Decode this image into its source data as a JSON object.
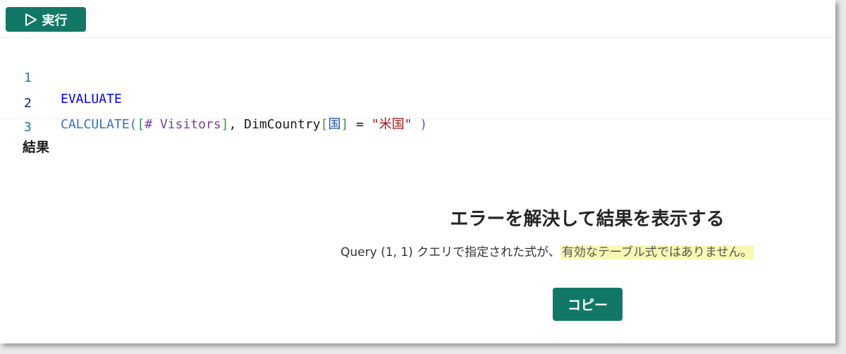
{
  "toolbar": {
    "run_label": "実行",
    "run_icon": "play-outline-icon",
    "accent": "#117865"
  },
  "editor": {
    "lines": [
      {
        "number": "1",
        "text": "EVALUATE"
      },
      {
        "number": "2",
        "text": "CALCULATE([# Visitors], DimCountry[国] = \"米国\" )",
        "tokens": {
          "fn": "CALCULATE",
          "open_paren": "(",
          "open_bracket": "[",
          "measure": "# Visitors",
          "close_bracket": "]",
          "comma": ",",
          "table": "DimCountry",
          "col_open": "[",
          "column": "国",
          "col_close": "]",
          "eq": "=",
          "string": "\"米国\"",
          "close_paren": ")"
        }
      },
      {
        "number": "3",
        "text": ""
      }
    ]
  },
  "results": {
    "label": "結果",
    "error_title": "エラーを解決して結果を表示する",
    "error_message_prefix": "Query (1, 1) クエリで指定された式が、",
    "error_message_highlight": "有効なテーブル式ではありません。",
    "highlight_color": "#f8f8b4",
    "copy_label": "コピー"
  }
}
